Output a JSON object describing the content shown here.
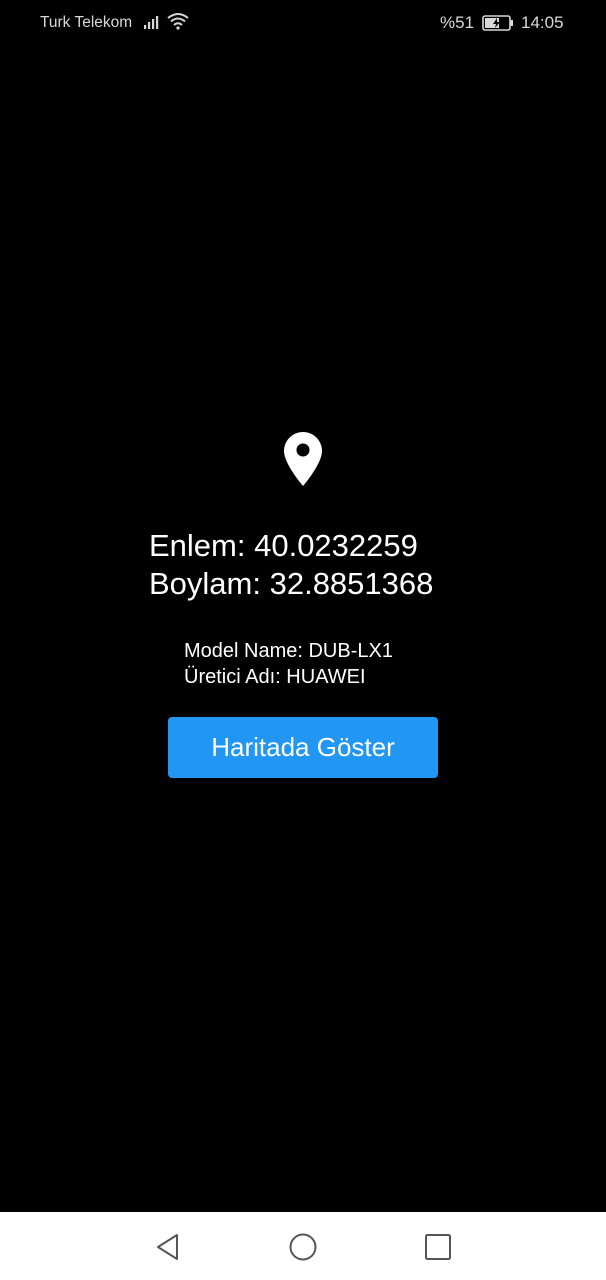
{
  "status_bar": {
    "carrier": "Turk Telekom",
    "battery_percent": "%51",
    "time": "14:05",
    "icons": [
      "signal-icon",
      "wifi-icon",
      "battery-charging-icon"
    ]
  },
  "location": {
    "icon": "location-pin-icon",
    "latitude_text": "Enlem: 40.0232259",
    "longitude_text": "Boylam: 32.8851368"
  },
  "device": {
    "model_text": "Model Name: DUB-LX1",
    "manufacturer_text": "Üretici Adı: HUAWEI"
  },
  "actions": {
    "show_on_map_label": "Haritada Göster"
  },
  "nav_bar": {
    "icons": [
      "back-icon",
      "home-icon",
      "recent-apps-icon"
    ]
  },
  "colors": {
    "background": "#000000",
    "button": "#2196f3",
    "text": "#ffffff",
    "nav_bar": "#ffffff"
  }
}
